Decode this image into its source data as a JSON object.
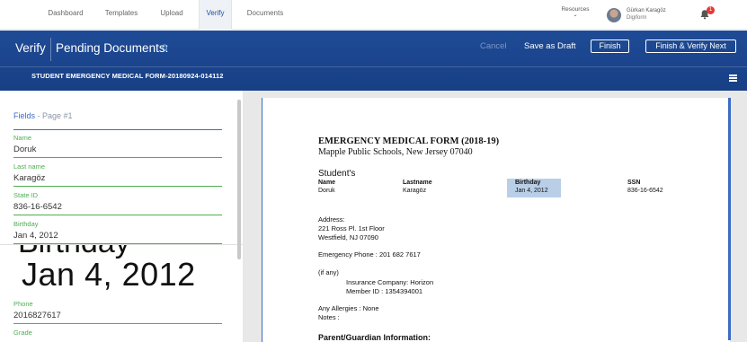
{
  "nav": {
    "tabs": [
      {
        "label": "Dashboard"
      },
      {
        "label": "Templates"
      },
      {
        "label": "Upload"
      },
      {
        "label": "Verify"
      },
      {
        "label": "Documents"
      }
    ],
    "active_tab": "Verify",
    "resources_label": "Resources",
    "user_name": "Gürkan Karagöz",
    "user_org": "Digiform",
    "notification_count": "1"
  },
  "header": {
    "title": "Verify",
    "pending_label": "Pending Documents:",
    "pending_count": "0",
    "cancel_label": "Cancel",
    "draft_label": "Save as Draft",
    "finish_label": "Finish",
    "finish_next_label": "Finish & Verify Next",
    "document_name": "STUDENT EMERGENCY MEDICAL FORM-20180924-014112"
  },
  "fields": {
    "title": "Fields",
    "page": "- Page #1",
    "items": [
      {
        "label": "Name",
        "value": "Doruk"
      },
      {
        "label": "Last name",
        "value": "Karagöz"
      },
      {
        "label": "State ID",
        "value": "836-16-6542"
      },
      {
        "label": "Birthday",
        "value": "Jan 4, 2012"
      },
      {
        "label": "Phone",
        "value": "2016827617"
      },
      {
        "label": "Grade",
        "value": ""
      }
    ],
    "zoom_top_text": "Birthday",
    "zoom_text": "Jan 4, 2012"
  },
  "document": {
    "title": "EMERGENCY MEDICAL FORM (2018-19)",
    "school": "Mapple Public Schools, New Jersey 07040",
    "students_heading": "Student's",
    "columns": [
      {
        "header": "Name",
        "value": "Doruk"
      },
      {
        "header": "Lastname",
        "value": "Karagöz"
      },
      {
        "header": "Birthday",
        "value": "Jan 4, 2012"
      },
      {
        "header": "SSN",
        "value": "836-16-6542"
      }
    ],
    "address_label": "Address:",
    "address_line1": "221 Ross Pl. 1st Floor",
    "address_line2": "Westfield, NJ 07090",
    "emergency_phone": "Emergency Phone : 201 682 7617",
    "if_any": "(if any)",
    "insurance_company": "Insurance Company: Horizon",
    "member_id": "Member ID : 1354394001",
    "allergies": "Any Allergies : None",
    "notes": "Notes :",
    "guardian_heading": "Parent/Guardian Information:"
  },
  "colors": {
    "header_blue": "#1f4b96",
    "field_green": "#4caf50",
    "accent_blue": "#3a6cc5",
    "highlight": "#b9cfe8",
    "badge_red": "#e53935"
  }
}
